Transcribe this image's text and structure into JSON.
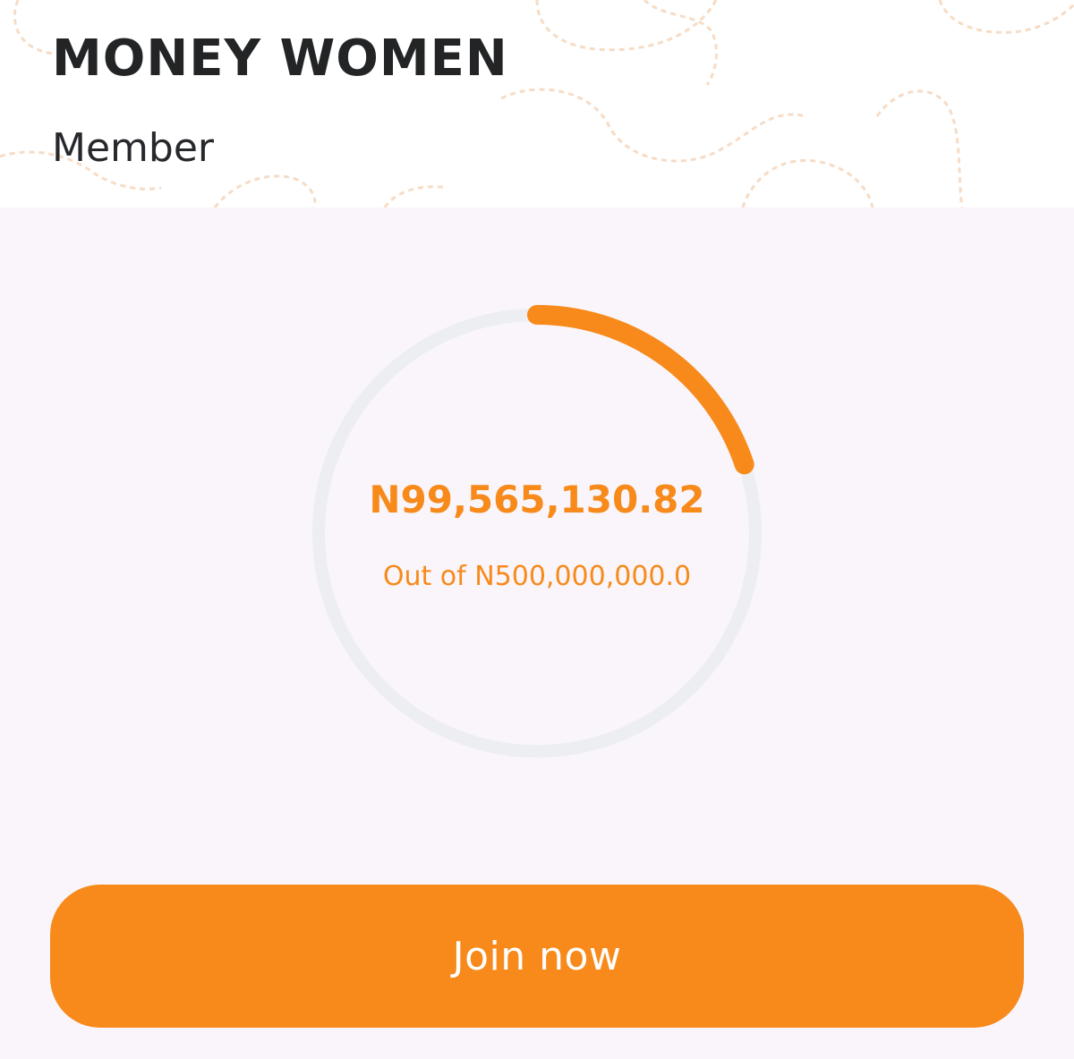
{
  "header": {
    "title": "MONEY WOMEN",
    "role": "Member"
  },
  "progress": {
    "amount": "N99,565,130.82",
    "target": "Out of N500,000,000.0",
    "fraction": 0.1991
  },
  "colors": {
    "accent": "#f78a1b",
    "track": "#eceef1",
    "background": "#f9f5fa"
  },
  "actions": {
    "join_label": "Join now"
  }
}
